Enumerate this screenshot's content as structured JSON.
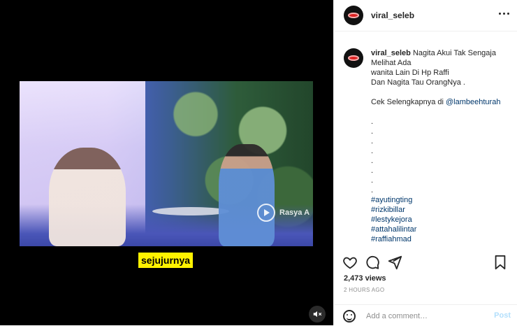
{
  "header": {
    "username": "viral_seleb"
  },
  "media": {
    "caption_overlay": "sejujurnya",
    "watermark": "Rasya A",
    "icons": [
      "mute-icon",
      "play-icon"
    ]
  },
  "post": {
    "username": "viral_seleb",
    "caption_lines": [
      "Nagita Akui Tak Sengaja",
      "Melihat Ada",
      "wanita Lain Di Hp Raffi",
      "Dan Nagita Tau OrangNya ."
    ],
    "cek_prefix": "Cek Selengkapnya di ",
    "mention": "@lambeehturah",
    "dots": [
      ".",
      ".",
      ".",
      ".",
      ".",
      ".",
      ".",
      "."
    ],
    "hashtags": [
      "#ayutingting",
      "#rizkibillar",
      "#lestykejora",
      "#attahalilintar",
      "#raffiahmad"
    ]
  },
  "stats": {
    "views": "2,473 views",
    "time": "2 HOURS AGO"
  },
  "comment_bar": {
    "placeholder": "Add a comment…",
    "post_label": "Post"
  },
  "icons": [
    "heart-icon",
    "comment-icon",
    "share-icon",
    "bookmark-icon",
    "emoji-icon",
    "more-icon"
  ]
}
